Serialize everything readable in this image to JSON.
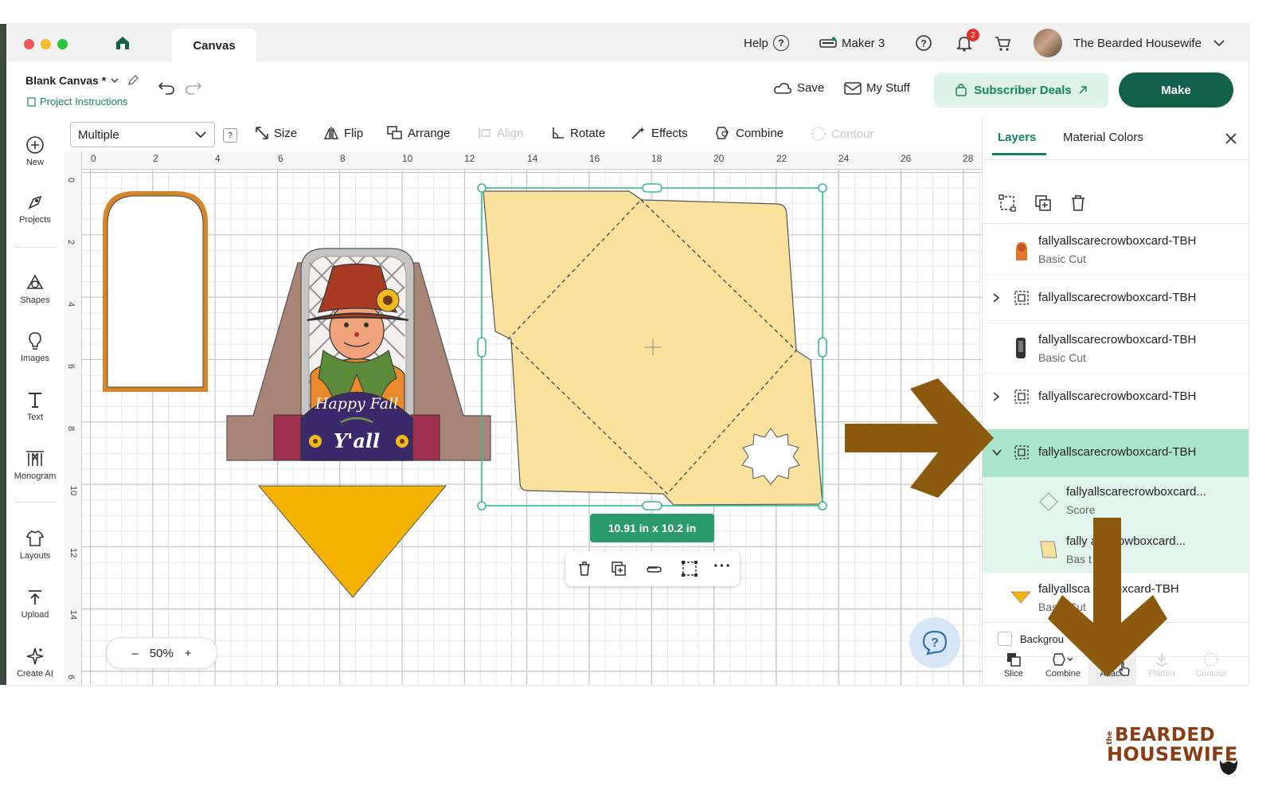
{
  "titlebar": {
    "tab": "Canvas",
    "help": "Help",
    "help_icon": "?",
    "machine": "Maker 3",
    "notification_count": "2",
    "user": "The Bearded Housewife"
  },
  "header": {
    "project_name": "Blank Canvas *",
    "project_instructions": "Project Instructions",
    "save": "Save",
    "my_stuff": "My Stuff",
    "subscriber_deals": "Subscriber Deals",
    "make": "Make"
  },
  "rail": [
    {
      "label": "New",
      "icon": "plus-circle-icon"
    },
    {
      "label": "Projects",
      "icon": "projects-icon"
    },
    {
      "label": "Shapes",
      "icon": "shapes-icon"
    },
    {
      "label": "Images",
      "icon": "lightbulb-icon"
    },
    {
      "label": "Text",
      "icon": "text-icon"
    },
    {
      "label": "Monogram",
      "icon": "monogram-icon"
    },
    {
      "label": "Layouts",
      "icon": "shirt-icon"
    },
    {
      "label": "Upload",
      "icon": "upload-icon"
    },
    {
      "label": "Create AI",
      "icon": "sparkle-icon"
    }
  ],
  "toolbar": {
    "select_value": "Multiple",
    "help_small": "?",
    "size": "Size",
    "flip": "Flip",
    "arrange": "Arrange",
    "align": "Align",
    "rotate": "Rotate",
    "effects": "Effects",
    "combine": "Combine",
    "contour": "Contour"
  },
  "ruler": {
    "top": [
      "0",
      "2",
      "4",
      "6",
      "8",
      "10",
      "12",
      "14",
      "16",
      "18",
      "20",
      "22",
      "24",
      "26",
      "28"
    ],
    "left": [
      "0",
      "2",
      "4",
      "6",
      "8",
      "10",
      "12",
      "14",
      "6"
    ]
  },
  "canvas": {
    "size_badge": "10.91  in x 10.2  in",
    "zoom": "50%",
    "zoom_minus": "–",
    "zoom_plus": "+",
    "card_text_top": "Happy Fall",
    "card_text_bottom": "Y'all",
    "minibar_more": "···"
  },
  "panel": {
    "tabs": [
      "Layers",
      "Material Colors"
    ],
    "layers": [
      {
        "name": "fallyallscarecrowboxcard-TBH",
        "sub": "Basic Cut",
        "chevron": ""
      },
      {
        "name": "fallyallscarecrowboxcard-TBH",
        "sub": "",
        "chevron": ">"
      },
      {
        "name": "fallyallscarecrowboxcard-TBH",
        "sub": "Basic Cut",
        "chevron": ""
      },
      {
        "name": "fallyallscarecrowboxcard-TBH",
        "sub": "",
        "chevron": ">"
      },
      {
        "name": "fallyallscarecrowboxcard-TBH",
        "sub": "",
        "chevron": "v"
      },
      {
        "name": "fallyallscarecrowboxcard...",
        "sub": "Score",
        "chevron": ""
      },
      {
        "name": "fally   arecrowboxcard...",
        "sub": "Bas      t",
        "chevron": ""
      },
      {
        "name": "fallyallsca      owboxcard-TBH",
        "sub": "Basic Cut",
        "chevron": ""
      }
    ],
    "background": "Backgrou",
    "bottom": [
      "Slice",
      "Combine",
      "Attach",
      "Flatten",
      "Contour"
    ]
  },
  "logo": {
    "top": "BEARDED",
    "bottom": "HOUSEWIFE",
    "prefix": "the"
  },
  "colors": {
    "make_green": "#14614a",
    "selection_teal": "#3bb98f",
    "arrow_brown": "#8b5a0e",
    "envelope_fill": "#fae29c",
    "triangle_fill": "#f5b301"
  }
}
